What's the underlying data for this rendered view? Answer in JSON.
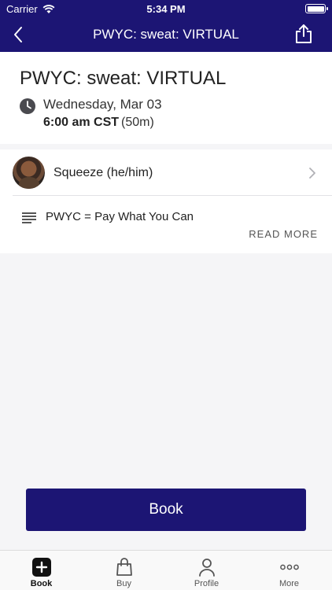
{
  "status_bar": {
    "carrier": "Carrier",
    "time": "5:34 PM"
  },
  "nav": {
    "title": "PWYC: sweat: VIRTUAL",
    "back_icon": "chevron-left-icon",
    "share_icon": "share-icon"
  },
  "class": {
    "title": "PWYC: sweat: VIRTUAL",
    "date": "Wednesday, Mar 03",
    "time": "6:00 am CST",
    "duration": "(50m)"
  },
  "instructor": {
    "name": "Squeeze (he/him)"
  },
  "description": {
    "text": "PWYC = Pay What You Can",
    "read_more": "READ MORE"
  },
  "book_button": {
    "label": "Book"
  },
  "tabs": [
    {
      "label": "Book",
      "icon": "plus-square-icon",
      "active": true
    },
    {
      "label": "Buy",
      "icon": "shopping-bag-icon",
      "active": false
    },
    {
      "label": "Profile",
      "icon": "person-icon",
      "active": false
    },
    {
      "label": "More",
      "icon": "ellipsis-icon",
      "active": false
    }
  ],
  "colors": {
    "brand": "#1c1574",
    "background": "#f5f5f7"
  }
}
